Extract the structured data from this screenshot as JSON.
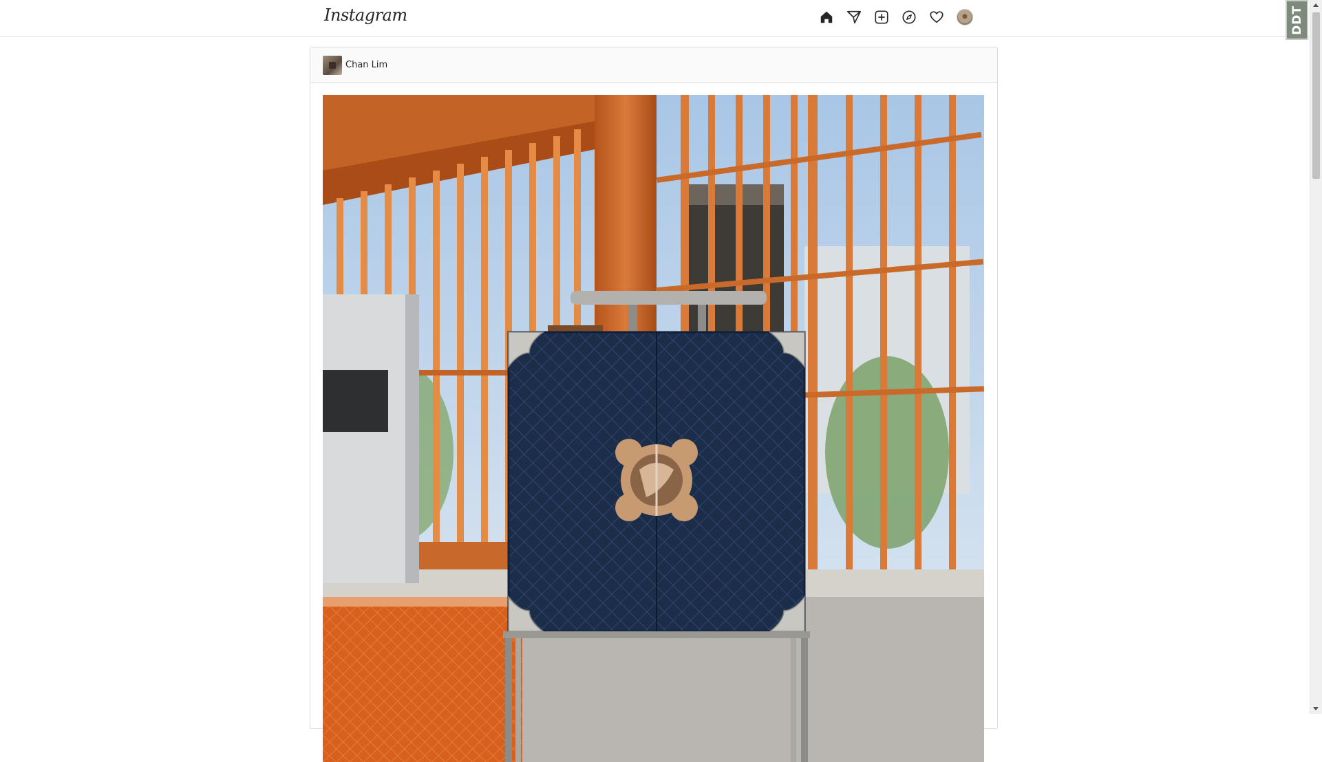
{
  "header": {
    "logo_text": "Instagram",
    "nav_icons": [
      "home-icon",
      "direct-message-icon",
      "new-post-icon",
      "explore-icon",
      "activity-heart-icon",
      "profile-avatar"
    ]
  },
  "post": {
    "username": "Chan Lim"
  },
  "extension_badge": {
    "label": "DDT"
  },
  "colors": {
    "border": "#dbdbdb",
    "header_bg": "#fafafa",
    "text": "#262626",
    "case_navy": "#1d2f4d",
    "wood": "#c8692a"
  }
}
